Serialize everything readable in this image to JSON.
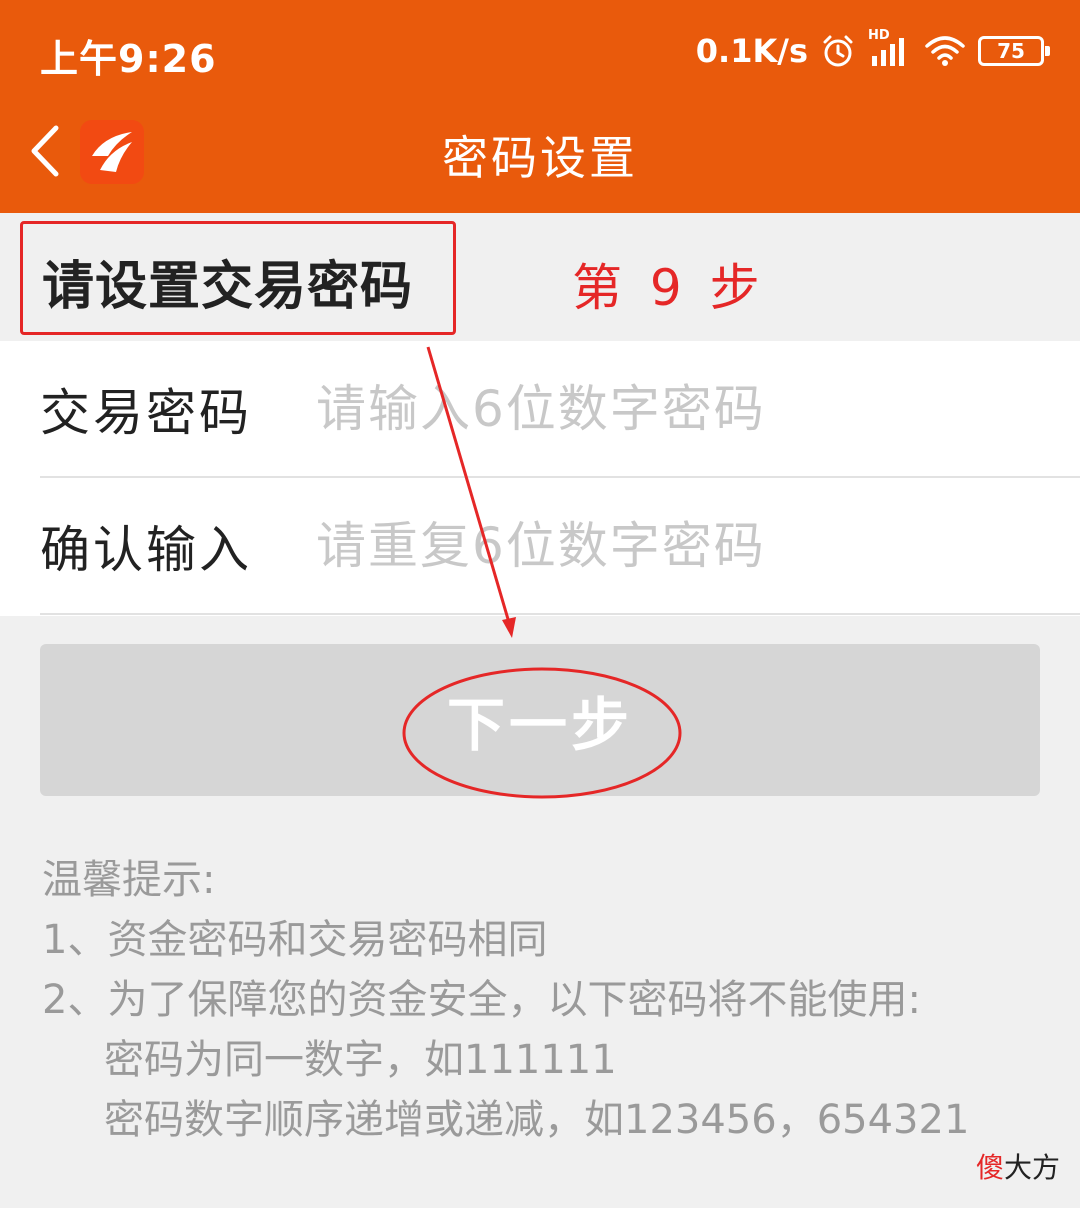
{
  "status_bar": {
    "time": "上午9:26",
    "net_speed": "0.1K/s",
    "network_badge": "HD",
    "battery": "75",
    "icons": [
      "alarm-icon",
      "signal-icon",
      "wifi-icon",
      "battery-icon"
    ]
  },
  "header": {
    "title": "密码设置",
    "back_icon": "chevron-left-icon",
    "logo_icon": "app-logo-icon",
    "background_color": "#e95a0c"
  },
  "section": {
    "title": "请设置交易密码"
  },
  "annotation": {
    "step_label": "第 9 步",
    "color": "#e52727"
  },
  "form": {
    "trade_password": {
      "label": "交易密码",
      "placeholder": "请输入6位数字密码",
      "value": ""
    },
    "confirm_password": {
      "label": "确认输入",
      "placeholder": "请重复6位数字密码",
      "value": ""
    }
  },
  "next_button": {
    "label": "下一步",
    "enabled": false,
    "color": "#d6d6d6"
  },
  "tips": {
    "title": "温馨提示:",
    "line1": "1、资金密码和交易密码相同",
    "line2": "2、为了保障您的资金安全，以下密码将不能使用:",
    "line3": "密码为同一数字，如111111",
    "line4": "密码数字顺序递增或递减，如123456，654321"
  },
  "watermark": {
    "part1": "傻",
    "part2": "大方"
  }
}
